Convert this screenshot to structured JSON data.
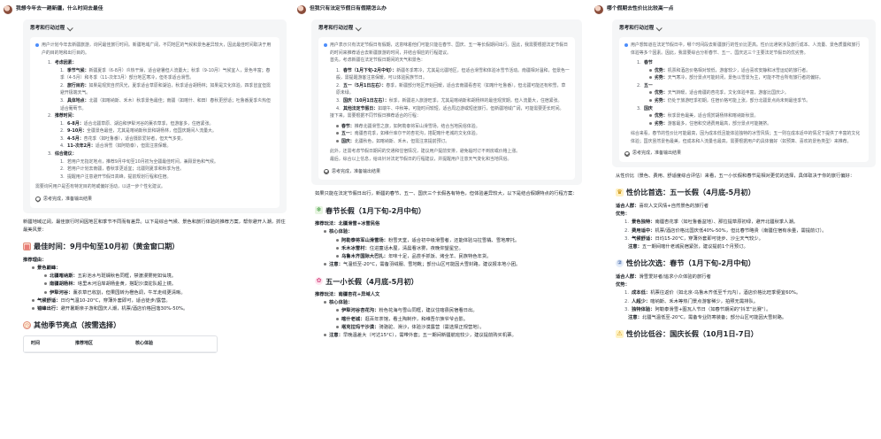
{
  "col1": {
    "question": "我想今年去一趟新疆，什么时间去最佳",
    "think_title": "思考和行动过程",
    "think_intro": "用户计划今年去新疆旅游，询问最佳旅行时间。新疆地域广阔，不同地区的气候和景色差异较大，因此最佳时间取决于用户的目的地和出行目的。",
    "sections": [
      {
        "num": "1.",
        "title": "考虑因素：",
        "items": [
          {
            "num": "1.",
            "label": "季节气候：",
            "text": "新疆夏季（6-8月）炎热干燥，适合避暑但人流量大；秋季（9-10月）气候宜人，景色丰富；春季（4-5月）和冬季（11-次年3月）部分地区寒冷，但冬季适合滑雪。"
          },
          {
            "num": "2.",
            "label": "旅行目的：",
            "text": "如果是观赏自然风光，夏季适合草原和湖泊，秋季适合胡杨林；如果是文化体验，四季皆宜但需避开极端天气。"
          },
          {
            "num": "3.",
            "label": "具体地点：",
            "text": "北疆（如喀纳斯、禾木）秋季景色最佳；南疆（如喀什、和田）春秋更舒适；吐鲁番夏季炎热但适合葡萄节。"
          }
        ]
      },
      {
        "num": "2.",
        "title": "推荐时间：",
        "items": [
          {
            "num": "1.",
            "label": "6-8月：",
            "text": "适合北疆草原、湖泊和伊犁河谷的薰衣草季，但游客多，住宿紧张。"
          },
          {
            "num": "2.",
            "label": "9-10月：",
            "text": "全疆景色最佳，尤其是喀纳斯秋景和胡杨林，但国庆期间人流量大。"
          },
          {
            "num": "3.",
            "label": "4-5月：",
            "text": "杏花季（如吐鲁番），适合摄影爱好者，但天气多变。"
          },
          {
            "num": "4.",
            "label": "11-次年2月：",
            "text": "适合滑雪（如阿勒泰），但需注意保暖。"
          }
        ]
      },
      {
        "num": "3.",
        "title": "综合建议：",
        "items": [
          {
            "num": "1.",
            "label": "",
            "text": "若用户无指定地点，推荐9月中旬至10月初为全疆最佳时间，兼顾景色和气候。"
          },
          {
            "num": "2.",
            "label": "",
            "text": "若用户计划去南疆，春秋季更适宜；北疆则夏季和秋季为佳。"
          },
          {
            "num": "3.",
            "label": "",
            "text": "提醒用户注意避开节假日高峰，提前规划行程和住宿。"
          }
        ]
      }
    ],
    "think_outro": "需要询问用户是否有特定目的地或偏好活动，以进一步个性化建议。",
    "done": "思考完成，准备输出结果",
    "answer_intro": "新疆地域辽阔，最佳旅行时间因地区和季节不同而有差异。以下是综合气候、景色和旅行体验的推荐方案，帮你避开人潮，抓住最美风景：",
    "h_best": "最佳时间：9月中旬至10月初（黄金窗口期）",
    "reason_label": "推荐理由：",
    "reasons": [
      {
        "label": "景色巅峰：",
        "text": "",
        "subs": [
          {
            "label": "北疆喀纳斯：",
            "text": "五彩池水与斑斓秋色同框，禁渡漫雾宛如仙境。"
          },
          {
            "label": "南疆胡杨林：",
            "text": "塔里木河沿岸胡杨金黄，搭配沙漠驼队超上镜。"
          },
          {
            "label": "伊犁河谷：",
            "text": "薰衣草已收割，但果园转为橙色调，牛羊走线更清晰。"
          }
        ]
      },
      {
        "label": "气候舒适：",
        "text": "日均气温10-20°C，穿薄外套即可，适合徒步/露营。",
        "subs": []
      },
      {
        "label": "错峰出行：",
        "text": "避开暑期亲子游和国庆人潮，机票/酒店价格回落30%-50%。",
        "subs": []
      }
    ],
    "h_other": "其他季节亮点（按需选择）",
    "table_headers": [
      "时间",
      "推荐地区",
      "核心体验"
    ]
  },
  "col2": {
    "question": "但我只有法定节假日有假期怎么办",
    "think_title": "思考和行动过程",
    "think_intro": "用户表示只有法定节假日有假期，这意味着他们可能只能在春节、国庆、五一等长假期间出行。因此，我需要根据法定节假日的时间来推荐适合去新疆旅游的时间，并结合相应的行程建议。",
    "think_line2": "首先，考虑新疆在法定节假日期间的天气和景色：",
    "holidays": [
      {
        "num": "1.",
        "label": "春节（1月下旬-2月中旬）：",
        "text": "新疆冬季寒冷，尤其是北疆地区，但适合滑雪和体验冰雪节活动。南疆相对温和，但景色一般，需提醒游客注意保暖，可以体验民族节日。"
      },
      {
        "num": "2.",
        "label": "五一（5月1日左右）：",
        "text": "春季，新疆部分地区开始回暖，适合去南疆看杏花（如喀什吐鲁番），但北疆可能还有积雪，草原未绿。"
      },
      {
        "num": "3.",
        "label": "国庆（10月1日左右）：",
        "text": "秋季，新疆进入旅游旺季，尤其是喀纳斯和胡杨林的最佳观赏期，但人流量大，住宿紧张。"
      },
      {
        "num": "4.",
        "label": "其他法定节假日：",
        "text": "如端午、中秋等，可能时间较短，适合周边游或短途旅行，但新疆地域广阔，可能需要更长时间。"
      }
    ],
    "think_line3": "接下来，需要根据不同节假日推荐适合的行程：",
    "plans": [
      {
        "label": "春节：",
        "text": "推荐北疆滑雪之旅，如阿勒泰将军山滑雪场，结合当地民俗体验。"
      },
      {
        "label": "五一：",
        "text": "南疆杏花季，如维什库尔干的杏花沟，搭配喀什老城的文化体验。"
      },
      {
        "label": "国庆：",
        "text": "北疆秋色，如喀纳斯、禾木，但需注意提前预订。"
      }
    ],
    "think_line4": "此外，还需考虑节假日期间的交通和住宿情况，建议用户提前安排，避免临时订不到房或价格上涨。",
    "think_line5": "最后，综合以上信息，给出针对法定节假日的行程建议，并提醒用户注意天气变化和当地风俗。",
    "done": "思考完成，准备输出结果",
    "answer_intro": "如果只能在法定节假日出行，新疆的春节、五一、国庆三个长假各有特色，但体验差异较大，以下是结合假期特点的行程方案：",
    "h_spring": "春节长假（1月下旬-2月中旬）",
    "spring_rec_label": "推荐玩法：",
    "spring_rec": "北疆滑雪+冰雪民俗",
    "core_label": "核心体验：",
    "spring_items": [
      {
        "label": "阿勒泰将军山滑雪场：",
        "text": "粉雪天堂，适合初中级滑雪者，还能体验马拉雪橇、雪地摩托。"
      },
      {
        "label": "禾木冰雪村：",
        "text": "住进童话木屋，清晨看冰雾，夜晚仰望星空。"
      },
      {
        "label": "乌鲁木齐国际大巴扎：",
        "text": "年味十足，品尝手抓饭、烤全羊、民族特色年货。"
      }
    ],
    "spring_warn": "注意：",
    "spring_warn_text": "气温低至-20°C，需备羽绒服、雪地靴；部分山区可能因大雪封路，建议报本地小团。",
    "h_may": "五一小长假（4月底-5月初）",
    "may_rec_label": "推荐玩法：",
    "may_rec": "南疆杏花+异域人文",
    "may_items": [
      {
        "label": "伊犁河谷杏花沟：",
        "text": "粉色花海与雪山同框，建议住喀县民宿看日出。"
      },
      {
        "label": "喀什老城：",
        "text": "逛百年茶馆，看土陶制作，和维吾尔族爷爷合影。"
      },
      {
        "label": "塔克拉玛干沙漠：",
        "text": "骑骆驼、滑沙，体验沙漠露营（需选择正规营地）。"
      }
    ],
    "may_warn": "注意：",
    "may_warn_text": "早晚温差大（可达15°C），需带外套；五一期间新疆航班较少，建议提前购买机票。"
  },
  "col3": {
    "question": "哪个假期去性价比比较高一点",
    "think_title": "思考和行动过程",
    "think_intro": "用户想知道在法定节假日中，哪个时间段去新疆旅行的性价比更高。性价比通常涉及旅行成本、人流量、景色质量和旅行体验等多个因素。因此，我需要综合分析春节、五一、国庆这三个主要法定节假日的优劣势。",
    "hols": [
      {
        "num": "1.",
        "title": "春节",
        "items": [
          {
            "label": "优势：",
            "text": "机票和酒店价格相对较低，游客较少，适合喜欢安静和冰雪运动的旅行者。"
          },
          {
            "label": "劣势：",
            "text": "天气寒冷，部分景点可能封闭，景色以雪景为主，可能不符合所有旅行者的偏好。"
          }
        ]
      },
      {
        "num": "2.",
        "title": "五一",
        "items": [
          {
            "label": "优势：",
            "text": "天气转暖，适合南疆的杏花季，文化体验丰富，游客比国庆少。"
          },
          {
            "label": "劣势：",
            "text": "仍处于旅游旺季初期，住宿价格可能上涨，部分北疆景点尚未到最佳季节。"
          }
        ]
      },
      {
        "num": "3.",
        "title": "国庆",
        "items": [
          {
            "label": "优势：",
            "text": "秋季景色最美，适合观赏胡杨林和喀纳斯秋景。"
          },
          {
            "label": "劣势：",
            "text": "游客最多，住宿和交通费用最高，部分景点可能拥挤。"
          }
        ]
      }
    ],
    "think_line2": "综合来看，春节的性价比可能最高，因为成本低且能体验独特的冰雪风情；五一则在成本适中的情况下提供了丰富的文化体验；国庆虽然景色最美，但成本和人流量也最高，需要根据用户的具体偏好（如预算、喜欢的景色类型）来推荐。",
    "done": "思考完成，准备输出结果",
    "answer_intro": "从性价比（景色、费用、舒适度综合评估）来看，五一小长假和春节是相对更优的选择，具体取决于你的旅行偏好：",
    "h_first": "性价比首选：五一长假（4月底-5月初）",
    "first_fit_label": "适合人群：",
    "first_fit": "喜欢人文风情+自然景色的旅行者",
    "adv_label": "优势：",
    "first_items": [
      {
        "label": "景色独特：",
        "text": "南疆杏花季（如吐鲁番盆地）、那拉提草原初绿，避开北疆秋季人潮。"
      },
      {
        "label": "费用适中：",
        "text": "机票/酒店价格比国庆低40%-50%，但比春节略贵（南疆住宿有余量，需提前订）。"
      },
      {
        "label": "气候舒适：",
        "text": "日均15-20°C，穿薄外套即可徒步、沙尘天气较少。"
      }
    ],
    "first_warn": "注意：",
    "first_warn_text": "五一期间喀什老城民宿紧张，建议提前1个月预订。",
    "h_second": "性价比次选：春节（1月下旬-2月中旬）",
    "second_fit_label": "适合人群：",
    "second_fit": "滑雪爱好者/追求小众体验的旅行者",
    "second_items": [
      {
        "label": "成本低：",
        "text": "机票往返价（如北京-乌鲁木齐低至千元内），酒店价格比旺季便宜60%。"
      },
      {
        "label": "人超少：",
        "text": "喀纳斯、禾木等热门景点游客稀少，拍照无需排队。"
      },
      {
        "label": "独特体验：",
        "text": "阿勒泰滑雪+图瓦人节日（如春节期间的\"抖羊\"比赛\"）。"
      }
    ],
    "second_warn": "注意：",
    "second_warn_text": "北疆气温低至-20°C，需备专业防寒装备；部分山区可能因大雪封路。",
    "h_third": "性价比低谷：国庆长假（10月1日-7日）"
  }
}
